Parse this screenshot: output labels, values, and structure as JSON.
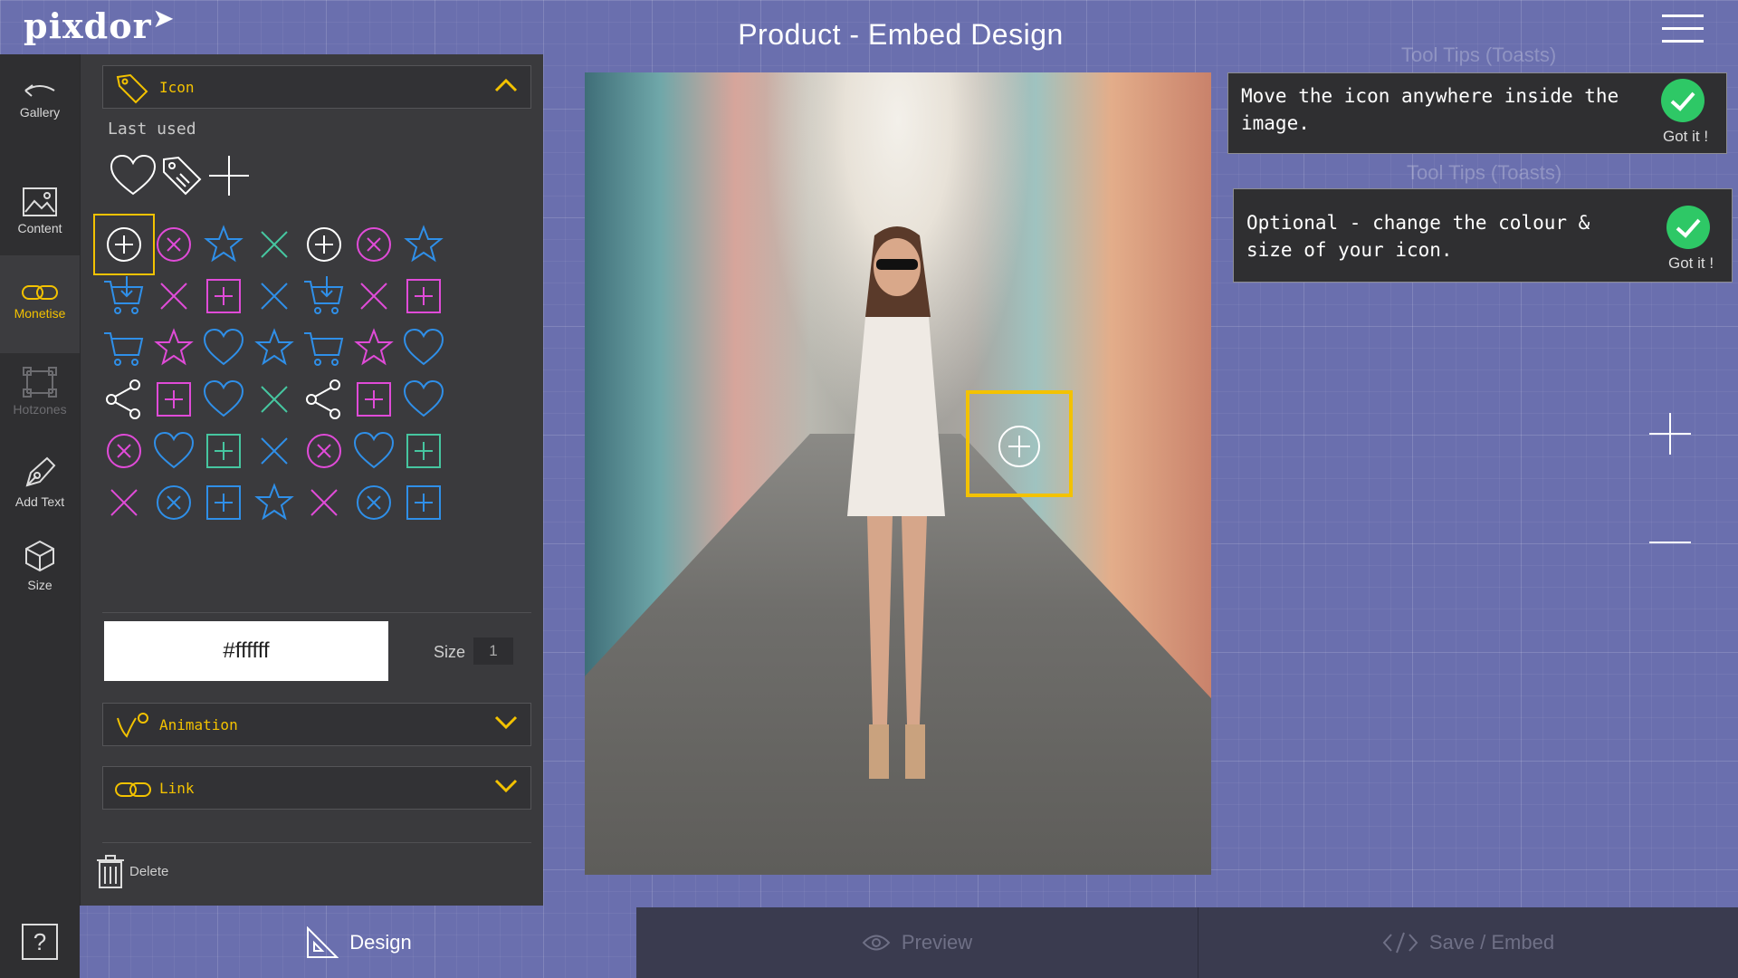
{
  "app": {
    "logo": "pixdor",
    "title": "Product - Embed Design"
  },
  "rail": {
    "items": [
      {
        "label": "Gallery",
        "icon": "back-arrow-icon"
      },
      {
        "label": "Content",
        "icon": "image-icon"
      },
      {
        "label": "Monetise",
        "icon": "link-icon"
      },
      {
        "label": "Hotzones",
        "icon": "hotzone-icon"
      },
      {
        "label": "Add Text",
        "icon": "pen-icon"
      },
      {
        "label": "Size",
        "icon": "cube-icon"
      }
    ],
    "help": "?"
  },
  "panel": {
    "icon_section": {
      "label": "Icon"
    },
    "last_used_label": "Last used",
    "color_value": "#ffffff",
    "size_label": "Size",
    "size_value": "1",
    "animation_section": {
      "label": "Animation"
    },
    "link_section": {
      "label": "Link"
    },
    "delete_label": "Delete"
  },
  "toasts": [
    {
      "title": "Tool Tips (Toasts)",
      "message": "Move the icon anywhere inside the image.",
      "button": "Got it !"
    },
    {
      "title": "Tool Tips (Toasts)",
      "message": "Optional - change the colour & size of your icon.",
      "button": "Got it !"
    }
  ],
  "tabs": {
    "design": "Design",
    "preview": "Preview",
    "save": "Save / Embed"
  },
  "colors": {
    "accent": "#f3c200",
    "pink": "#e04bd8",
    "blue": "#2f8fe8",
    "teal": "#46c6a0",
    "white": "#ffffff",
    "success": "#2ec866"
  }
}
